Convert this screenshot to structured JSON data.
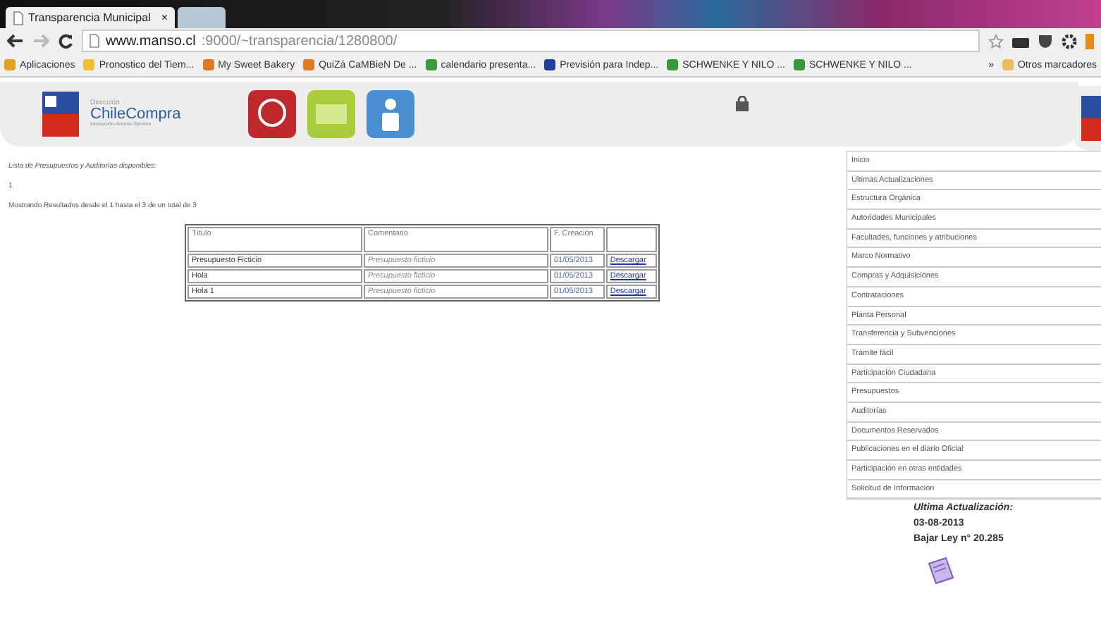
{
  "browser": {
    "tabs": [
      {
        "title": "Transparencia Municipal",
        "close": "×",
        "selected": true
      },
      {
        "selected": false
      }
    ],
    "url_host": "www.manso.cl",
    "url_path": ":9000/~transparencia/1280800/",
    "bookmarks": [
      {
        "label": "Aplicaciones",
        "color": "#e0a020"
      },
      {
        "label": "Pronostico del Tiem...",
        "color": "#f0c030"
      },
      {
        "label": "My Sweet Bakery",
        "color": "#e07a20"
      },
      {
        "label": "QuiZá CaMBieN De ...",
        "color": "#e07a20"
      },
      {
        "label": "calendario presenta...",
        "color": "#3c9a3c"
      },
      {
        "label": "Previsión para Indep...",
        "color": "#2040a0"
      },
      {
        "label": "SCHWENKE Y NILO ...",
        "color": "#3a9a3a"
      },
      {
        "label": "SCHWENKE Y NILO ...",
        "color": "#3a9a3a"
      }
    ],
    "overflow": "»",
    "other_bookmarks": "Otros marcadores"
  },
  "header": {
    "logo_small": "Dirección",
    "logo_name": "ChileCompra",
    "logo_tagline": "Innovación-Acceso-Servicio"
  },
  "page": {
    "heading": "Lista de Presupuestos y Auditorías disponibles:",
    "page_number": "1",
    "results": "Mostrando Resultados desde el 1 hasta el 3 de un total de 3",
    "table": {
      "columns": [
        "Título",
        "Comentario",
        "F. Creación",
        ""
      ],
      "rows": [
        {
          "titulo": "Presupuesto Ficticio",
          "comentario": "Presupuesto ficticio",
          "fecha": "01/05/2013",
          "link": "Descargar"
        },
        {
          "titulo": "Hola",
          "comentario": "Presupuesto ficticio",
          "fecha": "01/05/2013",
          "link": "Descargar"
        },
        {
          "titulo": "Hola 1",
          "comentario": "Presupuesto ficticio",
          "fecha": "01/05/2013",
          "link": "Descargar"
        }
      ]
    }
  },
  "sidebar": {
    "items": [
      "Inicio",
      "Últimas Actualizaciones",
      "Estructura Orgánica",
      "Autoridades Municipales",
      "Facultades, funciones y atribuciones",
      "Marco Normativo",
      "Compras y Adquisiciones",
      "Contrataciones",
      "Planta Personal",
      "Transferencia y Subvenciones",
      "Trámite fácil",
      "Participación Ciudadana",
      "Presupuestos",
      "Auditorías",
      "Documentos Reservados",
      "Publicaciones en el diario Oficial",
      "Participación en otras entidades",
      "Solicitud de Información"
    ],
    "update_label": "Ultima Actualización:",
    "update_date": "03-08-2013",
    "law": "Bajar Ley n° 20.285"
  }
}
